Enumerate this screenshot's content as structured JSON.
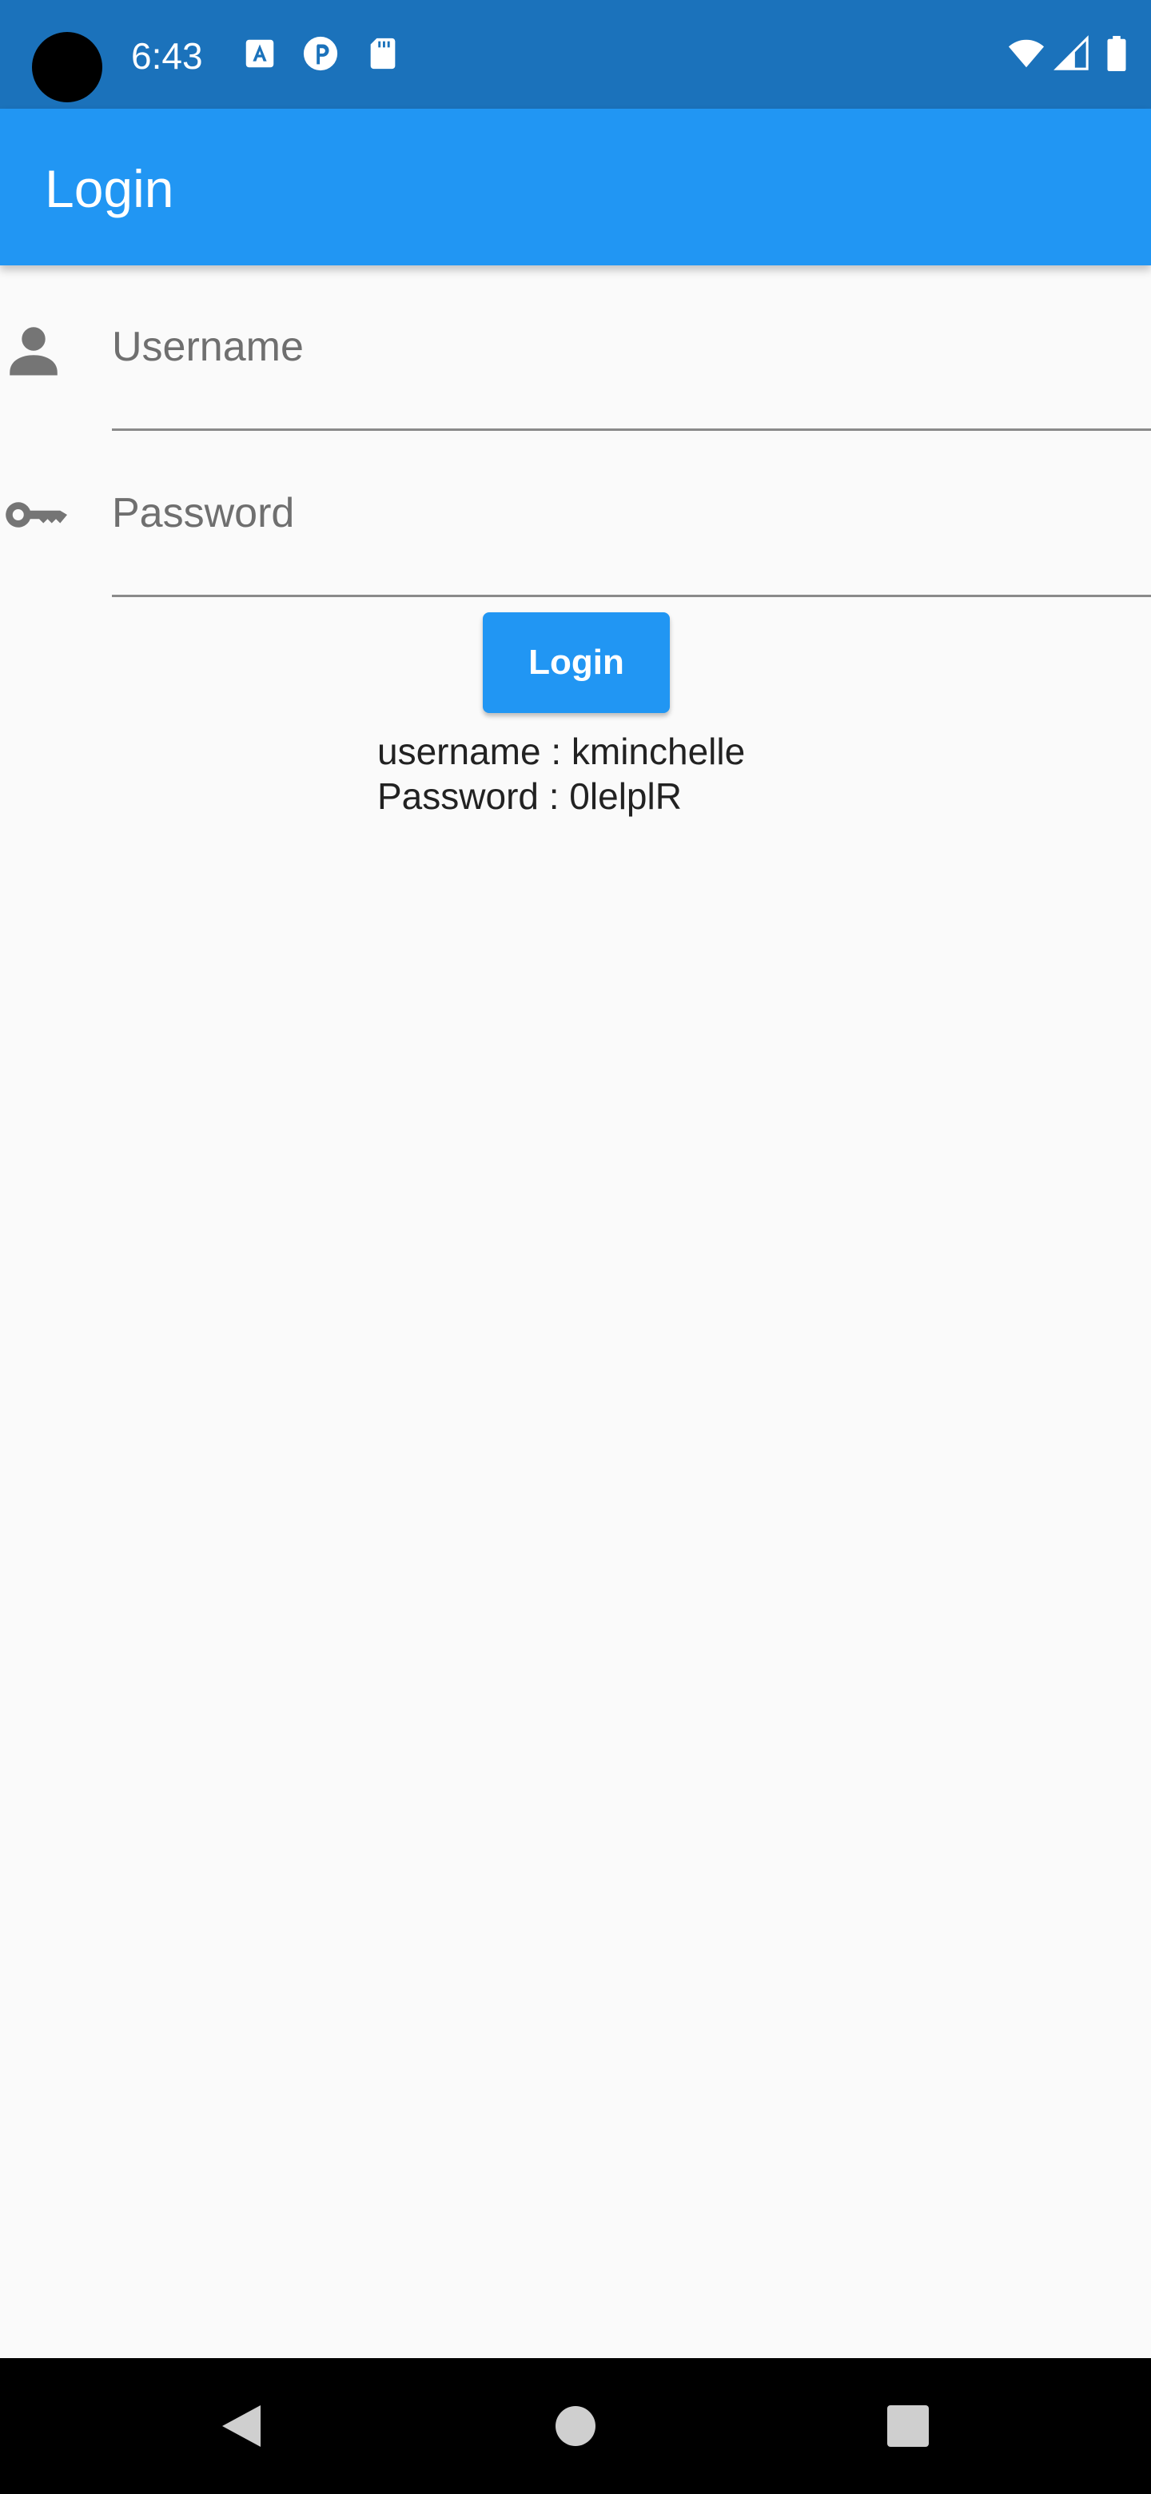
{
  "status_bar": {
    "time": "6:43",
    "left_icons": [
      "font-a-icon",
      "pinterest-icon",
      "sd-card-icon"
    ],
    "right_icons": [
      "wifi-icon",
      "cell-signal-icon",
      "battery-icon"
    ]
  },
  "app_bar": {
    "title": "Login"
  },
  "form": {
    "username": {
      "placeholder": "Username",
      "value": "",
      "icon": "person-icon"
    },
    "password": {
      "placeholder": "Password",
      "value": "",
      "icon": "key-icon"
    },
    "login_button_label": "Login"
  },
  "credentials": {
    "username_line": "username : kminchelle",
    "password_line": "Password : 0lelplR"
  },
  "nav_bar": {
    "buttons": [
      "back-icon",
      "home-icon",
      "recents-icon"
    ]
  },
  "colors": {
    "status_bar": "#1b72bb",
    "app_bar": "#2196f3",
    "button": "#2196f3",
    "background": "#fafafa"
  }
}
